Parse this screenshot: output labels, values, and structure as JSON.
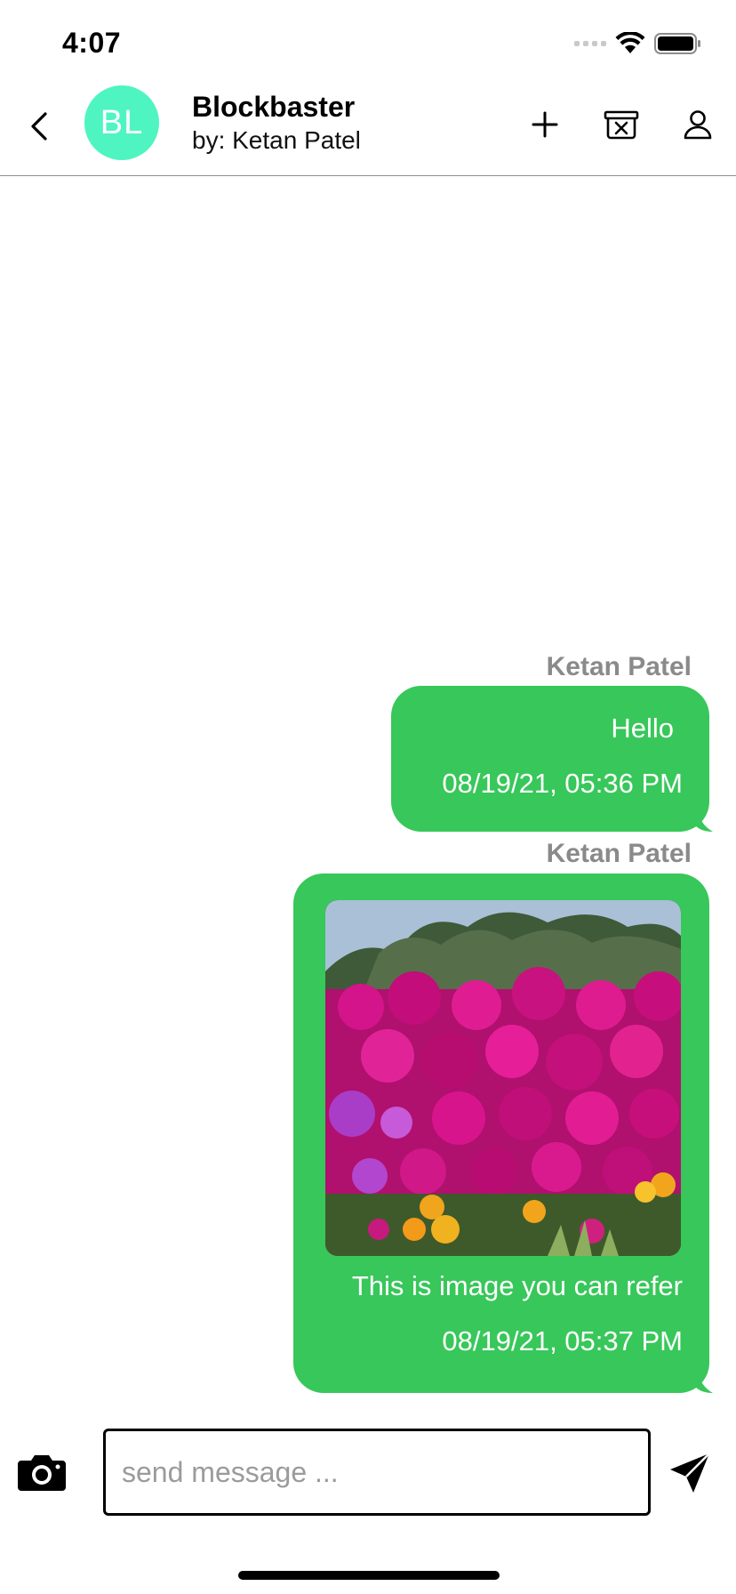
{
  "status_bar": {
    "time": "4:07"
  },
  "header": {
    "avatar_initials": "BL",
    "avatar_color": "#4ef5c0",
    "title": "Blockbaster",
    "subtitle": "by: Ketan Patel",
    "actions": [
      "plus-icon",
      "archive-x-icon",
      "person-icon"
    ]
  },
  "messages": [
    {
      "sender": "Ketan Patel",
      "text": "Hello",
      "timestamp": "08/19/21, 05:36 PM",
      "has_image": false
    },
    {
      "sender": "Ketan Patel",
      "text": "This is image you can refer",
      "timestamp": "08/19/21, 05:37 PM",
      "has_image": true
    }
  ],
  "composer": {
    "placeholder": "send message ...",
    "value": ""
  },
  "colors": {
    "bubble": "#38c75a",
    "sender_name": "#8a8a8a",
    "divider": "#8e8e8e"
  }
}
